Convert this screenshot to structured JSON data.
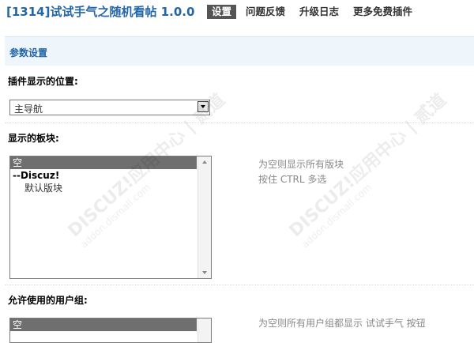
{
  "header": {
    "title": "[1314]试试手气之随机看帖 1.0.0",
    "tabs": [
      {
        "label": "设置",
        "active": true
      },
      {
        "label": "问题反馈",
        "active": false
      },
      {
        "label": "升级日志",
        "active": false
      },
      {
        "label": "更多免费插件",
        "active": false
      }
    ]
  },
  "section": {
    "title": "参数设置"
  },
  "position_setting": {
    "label": "插件显示的位置:",
    "selected": "主导航"
  },
  "forums_setting": {
    "label": "显示的板块:",
    "options": [
      {
        "text": "空",
        "selected": true,
        "kind": "normal"
      },
      {
        "text": "--Discuz!",
        "selected": false,
        "kind": "group"
      },
      {
        "text": "默认版块",
        "selected": false,
        "kind": "indent"
      }
    ],
    "hint_line1": "为空则显示所有版块",
    "hint_line2": "按住 CTRL 多选"
  },
  "groups_setting": {
    "label": "允许使用的用户组:",
    "first_option": "空",
    "hint_partial": "为空则所有用户组都显示 试试手气 按钮"
  },
  "watermark": {
    "line1": "DISCUZ!应用中心 | 贰道",
    "line2": "addon.dismall.com"
  },
  "colors": {
    "title": "#2366a8",
    "active_tab_bg": "#555555",
    "section_bg": "#eef5fb"
  }
}
